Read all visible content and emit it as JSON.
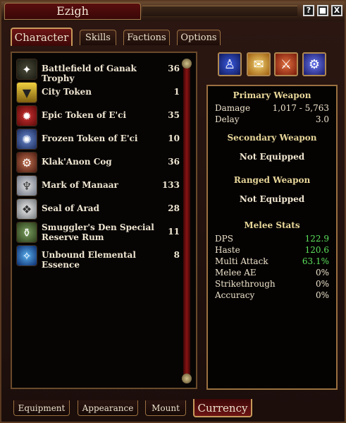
{
  "window": {
    "title": "Ezigh"
  },
  "title_buttons": {
    "help": "?",
    "minimize": "■",
    "close": "X"
  },
  "tabs": {
    "character": "Character",
    "skills": "Skills",
    "factions": "Factions",
    "options": "Options"
  },
  "currency": [
    {
      "name": "Battlefield of Ganak Trophy",
      "count": "36",
      "icon": "trophy-icon"
    },
    {
      "name": "City Token",
      "count": "1",
      "icon": "city-token-icon"
    },
    {
      "name": "Epic Token of E'ci",
      "count": "35",
      "icon": "epic-token-icon"
    },
    {
      "name": "Frozen Token of E'ci",
      "count": "10",
      "icon": "frozen-token-icon"
    },
    {
      "name": "Klak'Anon Cog",
      "count": "36",
      "icon": "cog-icon"
    },
    {
      "name": "Mark of Manaar",
      "count": "133",
      "icon": "mark-icon"
    },
    {
      "name": "Seal of Arad",
      "count": "28",
      "icon": "seal-icon"
    },
    {
      "name": "Smuggler's Den Special Reserve Rum",
      "count": "11",
      "icon": "rum-icon"
    },
    {
      "name": "Unbound Elemental Essence",
      "count": "8",
      "icon": "essence-icon"
    }
  ],
  "stats": {
    "primary": {
      "title": "Primary Weapon",
      "damage_label": "Damage",
      "damage": "1,017 - 5,763",
      "delay_label": "Delay",
      "delay": "3.0"
    },
    "secondary": {
      "title": "Secondary Weapon",
      "value": "Not Equipped"
    },
    "ranged": {
      "title": "Ranged Weapon",
      "value": "Not Equipped"
    },
    "melee": {
      "title": "Melee Stats",
      "rows": [
        {
          "label": "DPS",
          "value": "122.9"
        },
        {
          "label": "Haste",
          "value": "120.6"
        },
        {
          "label": "Multi Attack",
          "value": "63.1%"
        },
        {
          "label": "Melee AE",
          "value": "0%"
        },
        {
          "label": "Strikethrough",
          "value": "0%"
        },
        {
          "label": "Accuracy",
          "value": "0%"
        }
      ]
    }
  },
  "bottom_tabs": {
    "equipment": "Equipment",
    "appearance": "Appearance",
    "mount": "Mount",
    "currency": "Currency"
  }
}
